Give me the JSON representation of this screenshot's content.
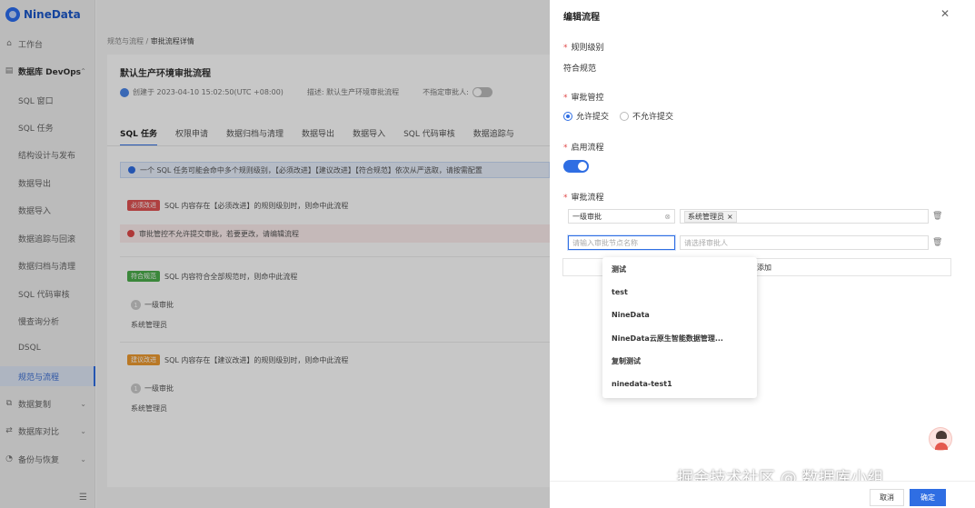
{
  "brand": {
    "name": "NineData"
  },
  "sidebar": {
    "items": [
      {
        "label": "工作台",
        "icon": "home-icon"
      },
      {
        "label": "数据库 DevOps",
        "icon": "database-icon",
        "expanded": true
      },
      {
        "label": "SQL 窗口"
      },
      {
        "label": "SQL 任务"
      },
      {
        "label": "结构设计与发布"
      },
      {
        "label": "数据导出"
      },
      {
        "label": "数据导入"
      },
      {
        "label": "数据追踪与回滚"
      },
      {
        "label": "数据归档与清理"
      },
      {
        "label": "SQL 代码审核"
      },
      {
        "label": "慢查询分析"
      },
      {
        "label": "DSQL"
      },
      {
        "label": "规范与流程",
        "active": true
      },
      {
        "label": "数据复制",
        "icon": "copy-icon"
      },
      {
        "label": "数据库对比",
        "icon": "compare-icon"
      },
      {
        "label": "备份与恢复",
        "icon": "backup-icon"
      }
    ],
    "footer_icon": "menu-collapse-icon"
  },
  "main": {
    "breadcrumb": {
      "parent": "规范与流程",
      "separator": "/",
      "current": "审批流程详情"
    },
    "title": "默认生产环境审批流程",
    "meta": {
      "created": "创建于 2023-04-10 15:02:50(UTC +08:00)",
      "description": "描述: 默认生产环境审批流程",
      "no_approver": "不指定审批人:"
    },
    "tabs": [
      "SQL 任务",
      "权限申请",
      "数据归档与清理",
      "数据导出",
      "数据导入",
      "SQL 代码审核",
      "数据追踪与"
    ],
    "active_tab": "SQL 任务",
    "info": "一个 SQL 任务可能会命中多个规则级别，【必须改进】【建议改进】【符合规范】依次从严选取，请按需配置",
    "rules": [
      {
        "tag": "必须改进",
        "text": "SQL 内容存在【必须改进】的规则级别时，则命中此流程"
      },
      {
        "tag": "符合规范",
        "text": "SQL 内容符合全部规范时，则命中此流程",
        "step": "一级审批",
        "approver": "系统管理员"
      },
      {
        "tag": "建议改进",
        "text": "SQL 内容存在【建议改进】的规则级别时，则命中此流程",
        "step": "一级审批",
        "approver": "系统管理员"
      }
    ],
    "warning": "审批管控不允许提交审批，若要更改，请编辑流程",
    "step_number": "1"
  },
  "drawer": {
    "title": "编辑流程",
    "rule_level": {
      "label": "规则级别",
      "value": "符合规范"
    },
    "control": {
      "label": "审批管控",
      "options": [
        "允许提交",
        "不允许提交"
      ],
      "selected": "允许提交"
    },
    "enable": {
      "label": "启用流程",
      "on": true
    },
    "flow": {
      "label": "审批流程",
      "rows": [
        {
          "name": "一级审批",
          "approver_chip": "系统管理员"
        },
        {
          "name_placeholder": "请输入审批节点名称",
          "approver_placeholder": "请选择审批人"
        }
      ],
      "add_label": "添加"
    },
    "dropdown_options": [
      "测试",
      "test",
      "NineData",
      "NineData云原生智能数据管理...",
      "复制测试",
      "ninedata-test1"
    ],
    "footer": {
      "cancel": "取消",
      "confirm": "确定"
    }
  },
  "watermark": "掘金技术社区 @ 数据库小组",
  "colors": {
    "accent": "#2f6ee3",
    "danger": "#e04848",
    "success": "#4cae4c",
    "warning": "#ee9a30"
  }
}
